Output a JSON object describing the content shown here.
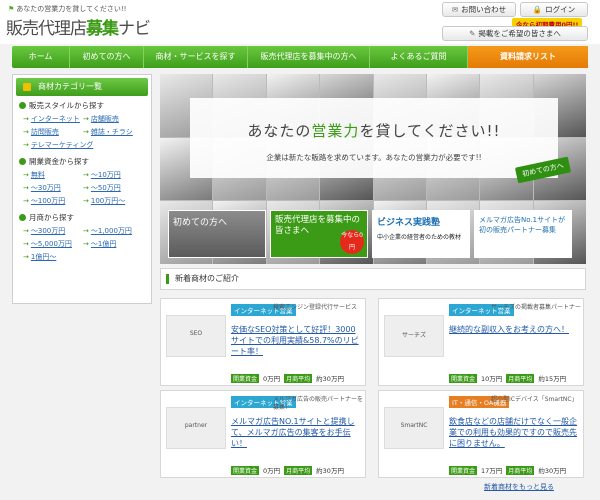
{
  "header": {
    "tagline": "あなたの営業力を貸してください!!",
    "logo_prefix": "販売代理店",
    "logo_accent": "募集",
    "logo_suffix": "ナビ",
    "contact": "お問い合わせ",
    "login": "ログイン",
    "promo": "今なら初期費用0円!!",
    "post": "掲載をご希望の皆さまへ"
  },
  "nav": [
    "ホーム",
    "初めての方へ",
    "商材・サービスを探す",
    "販売代理店を募集中の方へ",
    "よくあるご質問",
    "資料請求リスト"
  ],
  "sidebar": {
    "title": "商材カテゴリ一覧",
    "sections": [
      {
        "title": "販売スタイルから探す",
        "links": [
          "インターネット",
          "店舗販売",
          "訪問販売",
          "雑誌・チラシ",
          "テレマーケティング"
        ]
      },
      {
        "title": "開業資金から探す",
        "links": [
          "無料",
          "〜10万円",
          "〜30万円",
          "〜50万円",
          "〜100万円",
          "100万円〜"
        ]
      },
      {
        "title": "月商から探す",
        "links": [
          "〜300万円",
          "〜1,000万円",
          "〜5,000万円",
          "〜1億円",
          "1億円〜"
        ]
      }
    ]
  },
  "hero": {
    "headline_pre": "あなたの",
    "headline_accent": "営業力",
    "headline_post": "を貸してください!!",
    "sub": "企業は新たな販路を求めています。あなたの営業力が必要です!!",
    "badge": "初めての方へ",
    "banners": {
      "b1": "初めての方へ",
      "b2": "販売代理店を募集中の皆さまへ",
      "b2_note": "今なら0円",
      "b3": "ビジネス実践塾",
      "b3_sub": "中小企業の経営者のための教材",
      "b4": "メルマガ広告No.1サイトが初の販売パートナー募集"
    }
  },
  "new_items": {
    "title": "新着商材のご紹介",
    "cards": [
      {
        "tag": "インターネット営業",
        "category": "検索エンジン登録代行サービス",
        "title": "安価なSEO対策として好評！3000サイトでの利用実績&58.7%のリピート率！",
        "capital_label": "開業資金",
        "capital": "0万円",
        "monthly_label": "月商平均",
        "monthly": "約30万円",
        "thumb": "SEO"
      },
      {
        "tag": "インターネット営業",
        "category": "サーチズの掲載者募集パートナー",
        "title": "継続的な副収入をお考えの方へ！",
        "capital_label": "開業資金",
        "capital": "10万円",
        "monthly_label": "月商平均",
        "monthly": "約15万円",
        "thumb": "サーチズ"
      },
      {
        "tag": "インターネット営業",
        "category": "メルマガ広告の販売パートナーを募集！",
        "title": "メルマガ広告NO.1サイトと提携して、メルマガ広告の集客をお手伝い！",
        "capital_label": "開業資金",
        "capital": "0万円",
        "monthly_label": "月商平均",
        "monthly": "約30万円",
        "thumb": "partner"
      },
      {
        "tag": "IT・通信・OA機器",
        "category": "超小型ICデバイス「SmartNC」",
        "title": "飲食店などの店舗だけでなく一般企業での利用も効果的ですので販売先に困りません。",
        "capital_label": "開業資金",
        "capital": "17万円",
        "monthly_label": "月商平均",
        "monthly": "約30万円",
        "thumb": "SmartNC"
      }
    ],
    "more": "新着商材をもっと見る"
  }
}
